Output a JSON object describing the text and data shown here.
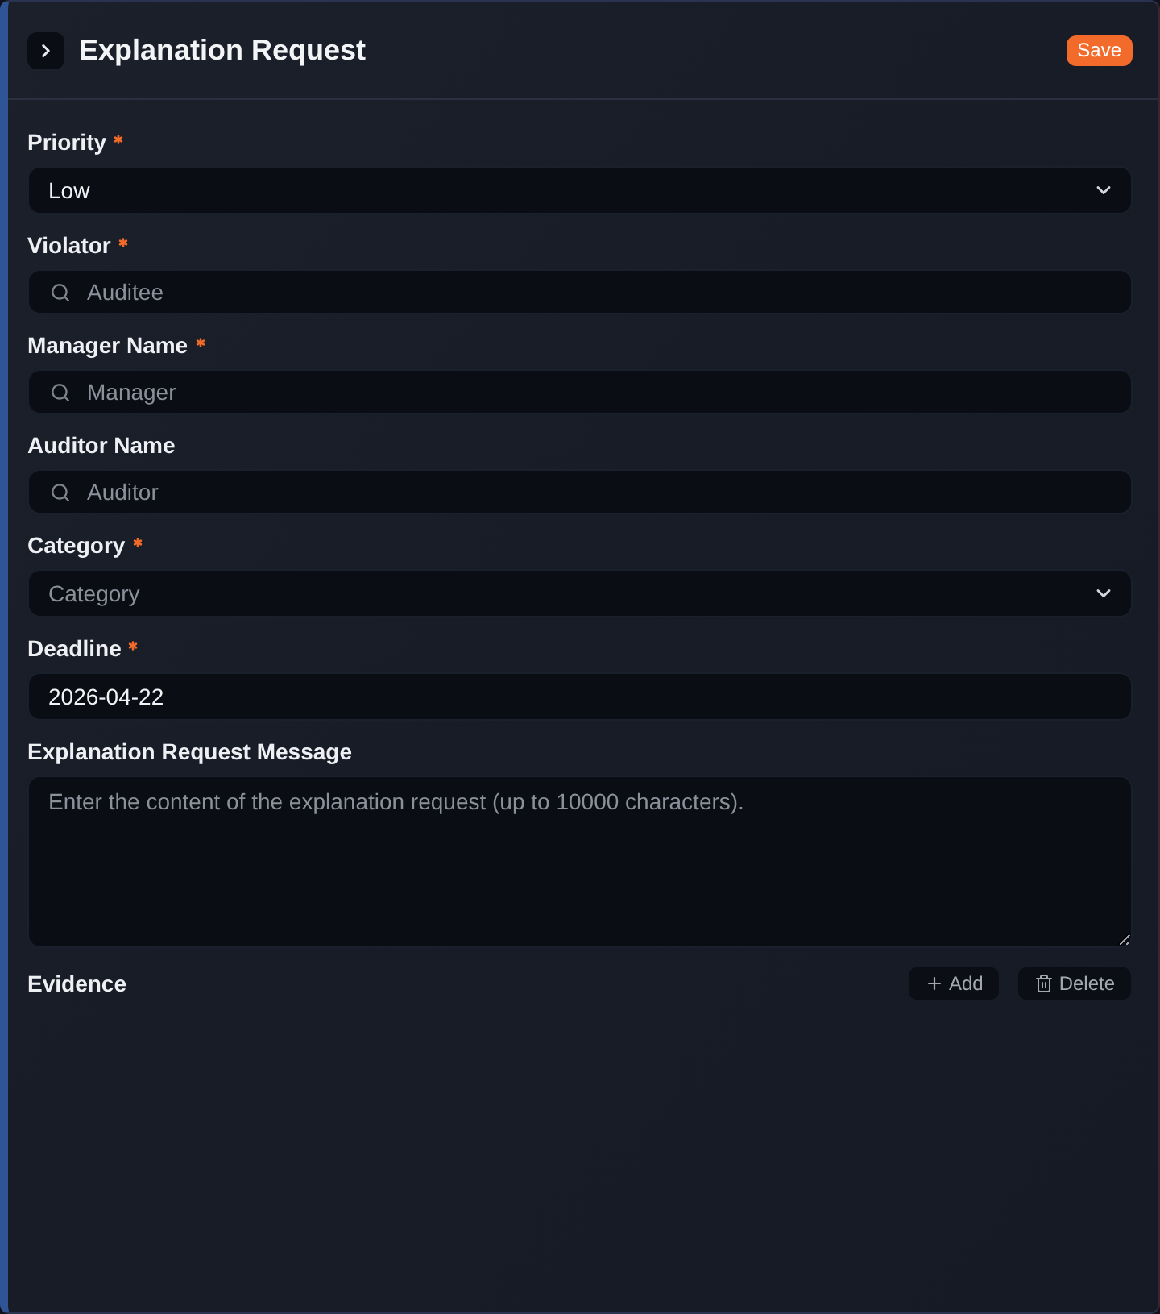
{
  "header": {
    "title": "Explanation Request",
    "save_button": "Save"
  },
  "fields": [
    {
      "kind": "select",
      "label": "Priority",
      "required": true,
      "value": "Low"
    },
    {
      "kind": "search",
      "label": "Violator",
      "required": true,
      "placeholder": "Auditee"
    },
    {
      "kind": "search",
      "label": "Manager Name",
      "required": true,
      "placeholder": "Manager"
    },
    {
      "kind": "search",
      "label": "Auditor Name",
      "required": false,
      "placeholder": "Auditor"
    },
    {
      "kind": "select",
      "label": "Category",
      "required": true,
      "placeholder": "Category"
    },
    {
      "kind": "text",
      "label": "Deadline",
      "required": true,
      "value": "2026-04-22"
    },
    {
      "kind": "textarea",
      "label": "Explanation Request Message",
      "required": false,
      "placeholder": "Enter the content of the explanation request (up to 10000 characters)."
    }
  ],
  "evidence": {
    "label": "Evidence",
    "add_button": "Add",
    "delete_button": "Delete"
  }
}
